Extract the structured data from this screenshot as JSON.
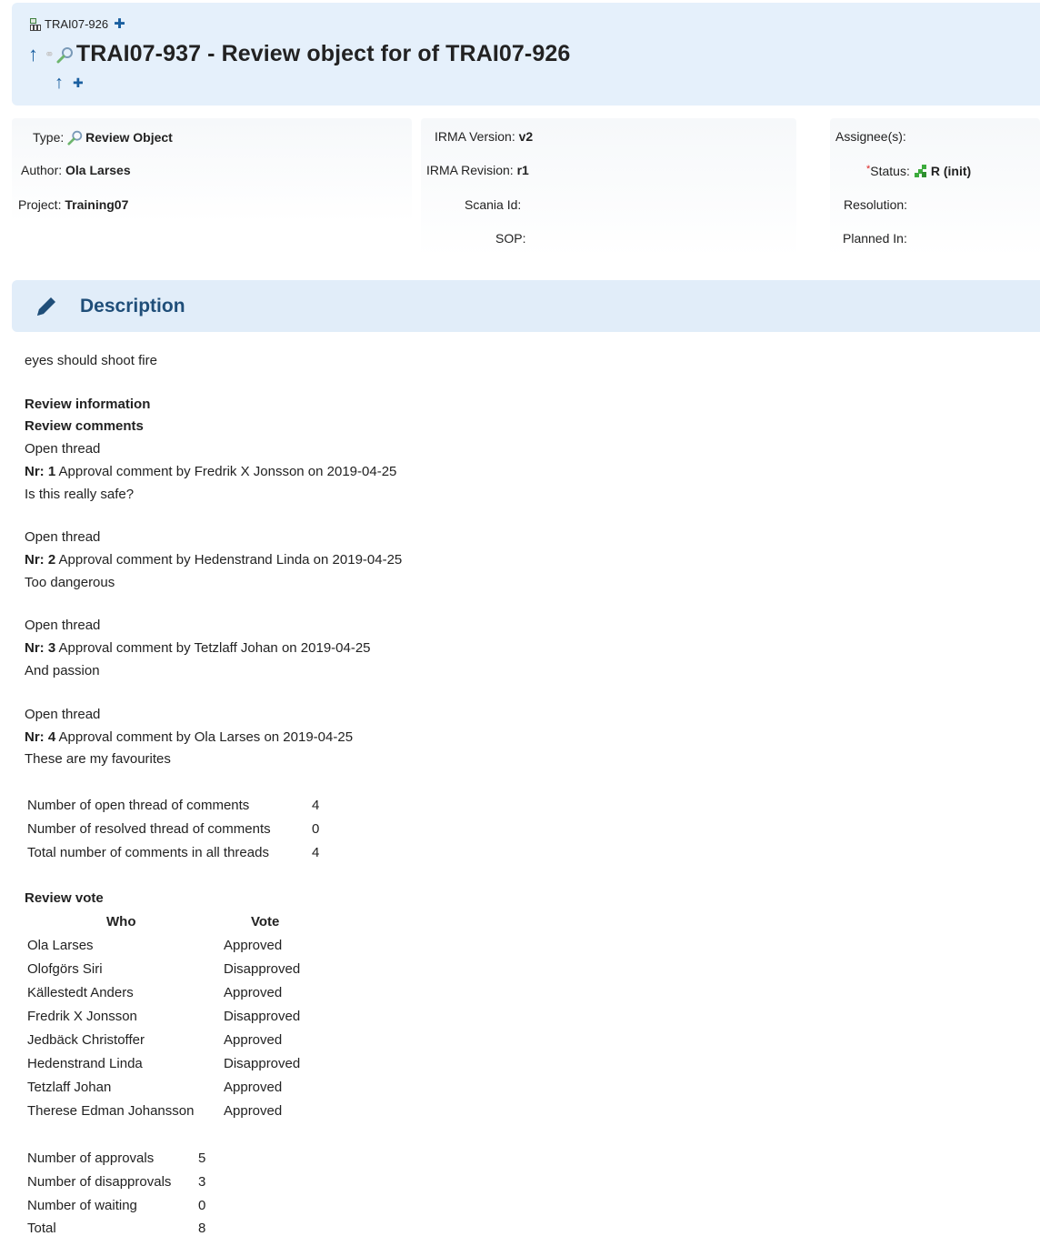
{
  "header": {
    "parent_id": "TRAI07-926",
    "title": "TRAI07-937 - Review object for of TRAI07-926",
    "parent_add_icon": "plus-icon",
    "up_icon": "arrow-up-icon"
  },
  "info": {
    "type_label": "Type:",
    "type_value": "Review Object",
    "author_label": "Author:",
    "author_value": "Ola Larses",
    "project_label": "Project:",
    "project_value": "Training07",
    "irma_version_label": "IRMA Version:",
    "irma_version_value": "v2",
    "irma_revision_label": "IRMA Revision:",
    "irma_revision_value": "r1",
    "scania_id_label": "Scania Id:",
    "sop_label": "SOP:",
    "assignees_label": "Assignee(s):",
    "status_star": "*",
    "status_label": "Status:",
    "status_value": "R (init)",
    "resolution_label": "Resolution:",
    "planned_in_label": "Planned In:"
  },
  "description": {
    "heading": "Description",
    "text": "eyes should shoot fire",
    "review_info_heading": "Review information",
    "review_comments_heading": "Review comments",
    "comments": [
      {
        "status": "Open thread",
        "nr_label": "Nr: 1",
        "meta": " Approval comment by Fredrik X Jonsson on 2019-04-25",
        "body": "Is this really safe?"
      },
      {
        "status": "Open thread",
        "nr_label": "Nr: 2",
        "meta": " Approval comment by Hedenstrand Linda on 2019-04-25",
        "body": "Too dangerous"
      },
      {
        "status": "Open thread",
        "nr_label": "Nr: 3",
        "meta": " Approval comment by Tetzlaff Johan on 2019-04-25",
        "body": "And passion"
      },
      {
        "status": "Open thread",
        "nr_label": "Nr: 4",
        "meta": " Approval comment by Ola Larses on 2019-04-25",
        "body": "These are my favourites"
      }
    ],
    "comment_stats": [
      {
        "label": "Number of open thread of comments",
        "value": "4"
      },
      {
        "label": "Number of resolved thread of comments",
        "value": "0"
      },
      {
        "label": "Total number of comments in all threads",
        "value": "4"
      }
    ],
    "review_vote_heading": "Review vote",
    "vote_headers": {
      "who": "Who",
      "vote": "Vote"
    },
    "votes": [
      {
        "who": "Ola Larses",
        "vote": "Approved"
      },
      {
        "who": "Olofgörs Siri",
        "vote": "Disapproved"
      },
      {
        "who": "Källestedt Anders",
        "vote": "Approved"
      },
      {
        "who": "Fredrik X Jonsson",
        "vote": "Disapproved"
      },
      {
        "who": "Jedbäck Christoffer",
        "vote": "Approved"
      },
      {
        "who": "Hedenstrand Linda",
        "vote": "Disapproved"
      },
      {
        "who": "Tetzlaff Johan",
        "vote": "Approved"
      },
      {
        "who": "Therese Edman Johansson",
        "vote": "Approved"
      }
    ],
    "vote_stats": [
      {
        "label": "Number of approvals",
        "value": "5"
      },
      {
        "label": "Number of disapprovals",
        "value": "3"
      },
      {
        "label": "Number of waiting",
        "value": "0"
      },
      {
        "label": "Total",
        "value": "8"
      }
    ]
  },
  "colors": {
    "header_bg": "#e5f0fb",
    "accent": "#1a5fa0",
    "heading_text": "#1f4e79",
    "status_icon": "#3cab3c"
  }
}
